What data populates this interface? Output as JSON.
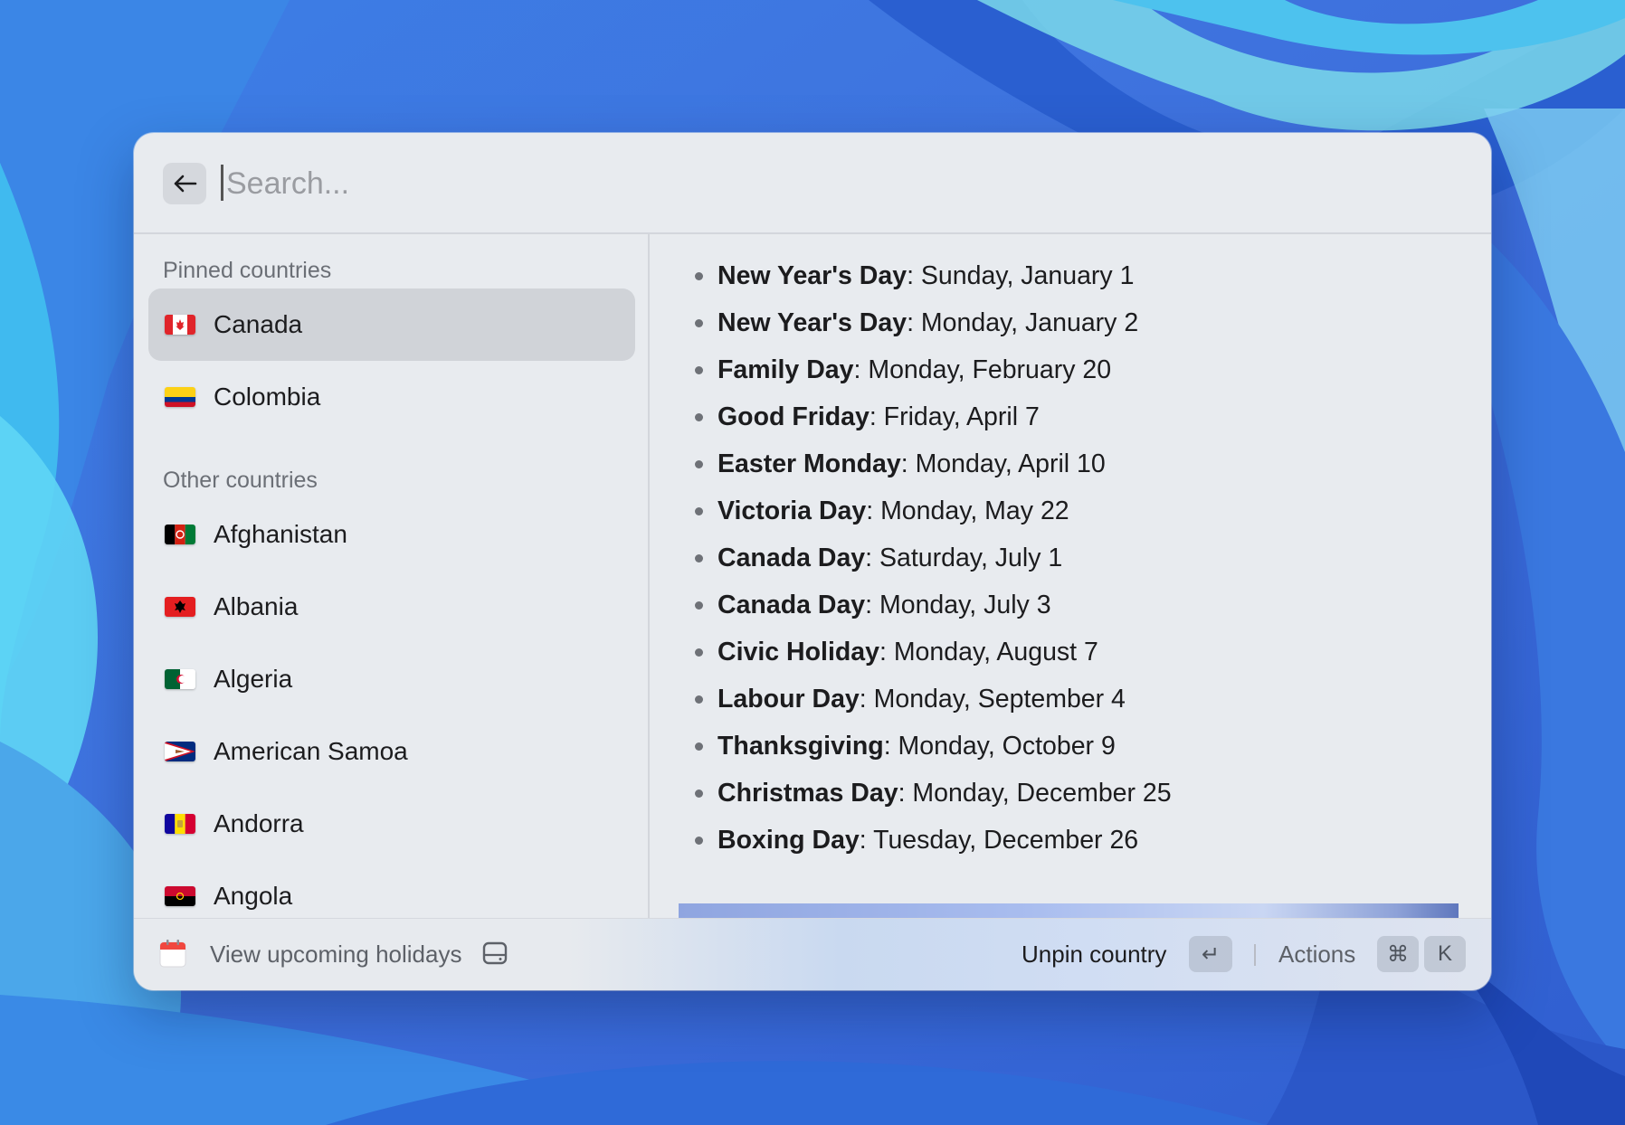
{
  "search": {
    "placeholder": "Search...",
    "value": ""
  },
  "sidebar": {
    "pinned_title": "Pinned countries",
    "other_title": "Other countries",
    "pinned": [
      {
        "label": "Canada",
        "flag": "canada-flag-icon",
        "selected": true
      },
      {
        "label": "Colombia",
        "flag": "colombia-flag-icon",
        "selected": false
      }
    ],
    "others": [
      {
        "label": "Afghanistan",
        "flag": "afghanistan-flag-icon"
      },
      {
        "label": "Albania",
        "flag": "albania-flag-icon"
      },
      {
        "label": "Algeria",
        "flag": "algeria-flag-icon"
      },
      {
        "label": "American Samoa",
        "flag": "american-samoa-flag-icon"
      },
      {
        "label": "Andorra",
        "flag": "andorra-flag-icon"
      },
      {
        "label": "Angola",
        "flag": "angola-flag-icon"
      }
    ]
  },
  "holidays": [
    {
      "name": "New Year's Day",
      "date": ": Sunday, January 1"
    },
    {
      "name": "New Year's Day",
      "date": ": Monday, January 2"
    },
    {
      "name": "Family Day",
      "date": ": Monday, February 20"
    },
    {
      "name": "Good Friday",
      "date": ": Friday, April 7"
    },
    {
      "name": "Easter Monday",
      "date": ": Monday, April 10"
    },
    {
      "name": "Victoria Day",
      "date": ": Monday, May 22"
    },
    {
      "name": "Canada Day",
      "date": ": Saturday, July 1"
    },
    {
      "name": "Canada Day",
      "date": ": Monday, July 3"
    },
    {
      "name": "Civic Holiday",
      "date": ": Monday, August 7"
    },
    {
      "name": "Labour Day",
      "date": ": Monday, September 4"
    },
    {
      "name": "Thanksgiving",
      "date": ": Monday, October 9"
    },
    {
      "name": "Christmas Day",
      "date": ": Monday, December 25"
    },
    {
      "name": "Boxing Day",
      "date": ": Tuesday, December 26"
    }
  ],
  "action_bar": {
    "view_label": "View upcoming holidays",
    "primary_action": "Unpin country",
    "enter_key": "↵",
    "actions_label": "Actions",
    "cmd_key": "⌘",
    "k_key": "K"
  },
  "colors": {
    "selected_row": "#d0d3d8",
    "window_bg": "#e8ebef",
    "wallpaper_base": "#3f7de0"
  }
}
